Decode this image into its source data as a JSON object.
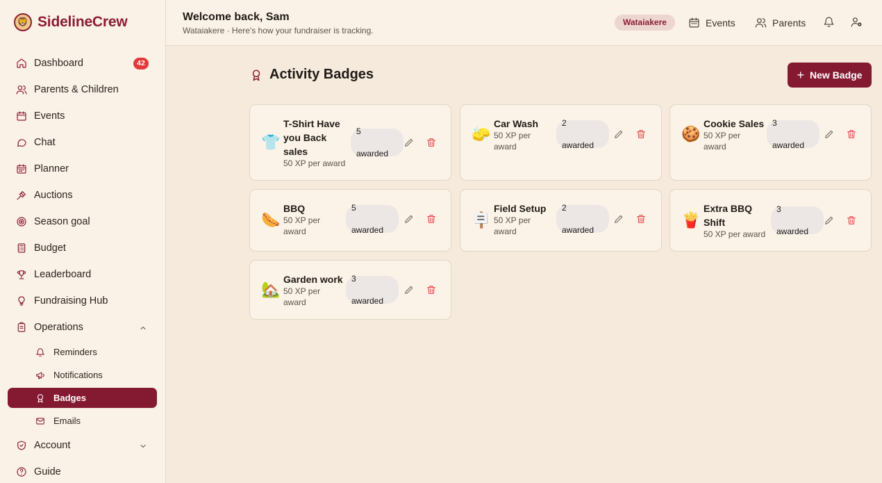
{
  "brand": {
    "name": "SidelineCrew",
    "logo_icon": "team-logo"
  },
  "sidebar": {
    "items": [
      {
        "label": "Dashboard",
        "icon": "home-icon",
        "count": "42"
      },
      {
        "label": "Parents & Children",
        "icon": "users-icon"
      },
      {
        "label": "Events",
        "icon": "calendar-icon"
      },
      {
        "label": "Chat",
        "icon": "chat-icon"
      },
      {
        "label": "Planner",
        "icon": "planner-icon"
      },
      {
        "label": "Auctions",
        "icon": "gavel-icon"
      },
      {
        "label": "Season goal",
        "icon": "target-icon"
      },
      {
        "label": "Budget",
        "icon": "calculator-icon"
      },
      {
        "label": "Leaderboard",
        "icon": "trophy-icon"
      },
      {
        "label": "Fundraising Hub",
        "icon": "lightbulb-icon"
      },
      {
        "label": "Operations",
        "icon": "clipboard-icon",
        "expanded": true
      }
    ],
    "operations_sub": [
      {
        "label": "Reminders",
        "icon": "bell-icon"
      },
      {
        "label": "Notifications",
        "icon": "megaphone-icon"
      },
      {
        "label": "Badges",
        "icon": "award-icon",
        "active": true
      },
      {
        "label": "Emails",
        "icon": "mail-icon"
      }
    ],
    "bottom": [
      {
        "label": "Account",
        "icon": "shield-icon",
        "expanded": false
      },
      {
        "label": "Guide",
        "icon": "help-icon"
      }
    ]
  },
  "header": {
    "welcome": "Welcome back, Sam",
    "subtitle": "Wataiakere · Here's how your fundraiser is tracking.",
    "club": "Wataiakere",
    "events_label": "Events",
    "parents_label": "Parents"
  },
  "main": {
    "title": "Activity Badges",
    "new_button": "New Badge",
    "badges": [
      {
        "emoji": "👕",
        "name": "T-Shirt Have you Back sales",
        "xp": "50 XP per award",
        "count": "5",
        "awarded": "awarded"
      },
      {
        "emoji": "🧽",
        "name": "Car Wash",
        "xp": "50 XP per award",
        "count": "2",
        "awarded": "awarded"
      },
      {
        "emoji": "🍪",
        "name": "Cookie Sales",
        "xp": "50 XP per award",
        "count": "3",
        "awarded": "awarded"
      },
      {
        "emoji": "🌭",
        "name": "BBQ",
        "xp": "50 XP per award",
        "count": "5",
        "awarded": "awarded"
      },
      {
        "emoji": "🪧",
        "name": "Field Setup",
        "xp": "50 XP per award",
        "count": "2",
        "awarded": "awarded"
      },
      {
        "emoji": "🍟",
        "name": "Extra BBQ Shift",
        "xp": "50 XP per award",
        "count": "3",
        "awarded": "awarded"
      },
      {
        "emoji": "🏡",
        "name": "Garden work",
        "xp": "50 XP per award",
        "count": "3",
        "awarded": "awarded"
      }
    ]
  },
  "colors": {
    "brand": "#8b1d33",
    "danger": "#e5484d",
    "background": "#f5eadb"
  }
}
